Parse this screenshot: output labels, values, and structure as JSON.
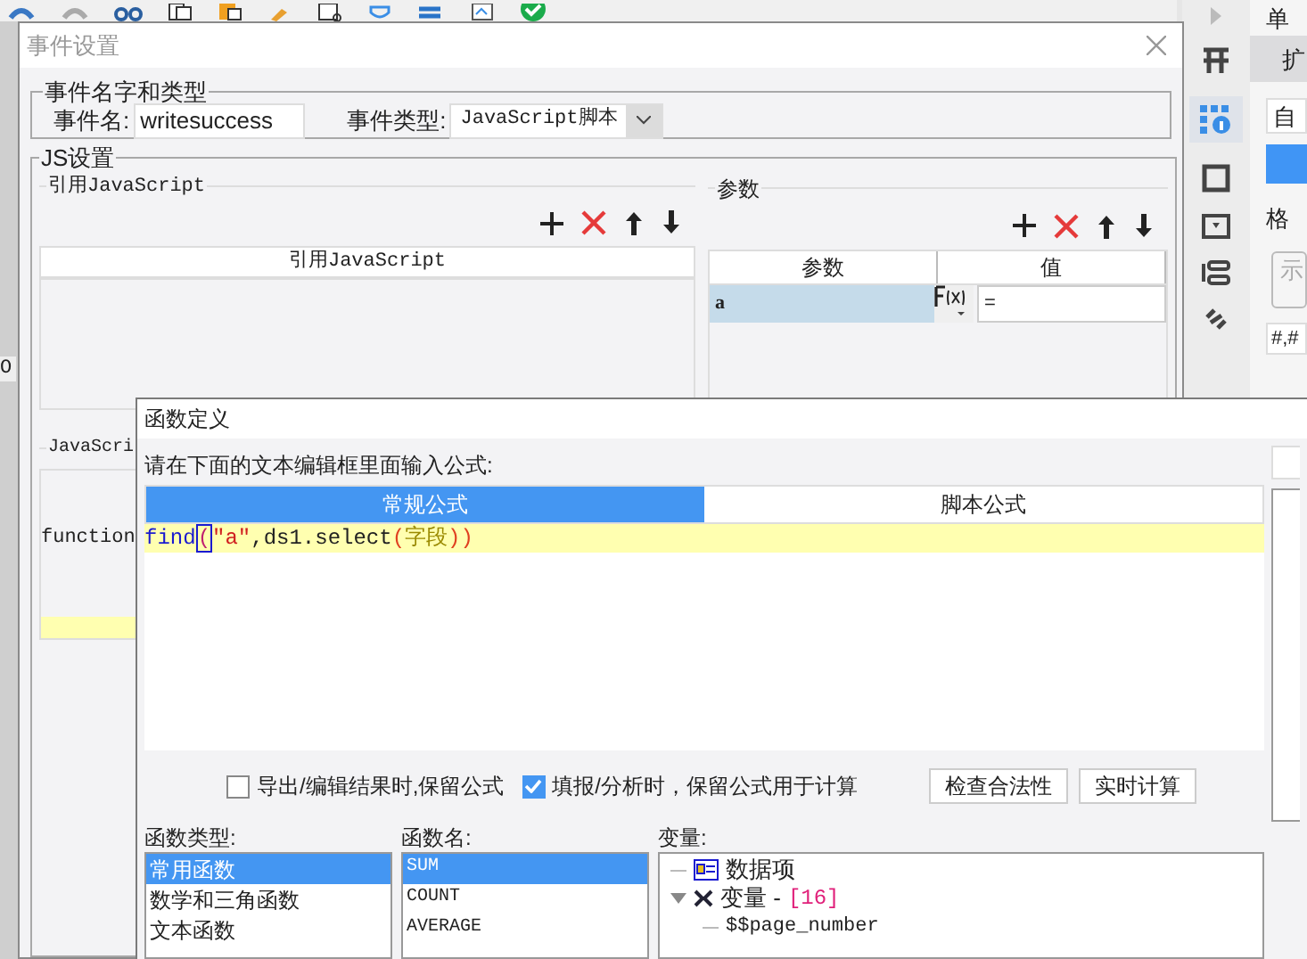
{
  "background": {
    "cell_text": "O"
  },
  "right_panel": {
    "title": "单",
    "tab": "扩",
    "format_field": "自",
    "format_label": "格",
    "sample_label": "示",
    "pattern_field": "#,#"
  },
  "event_dialog": {
    "title": "事件设置",
    "name_group": {
      "title": "事件名字和类型",
      "name_label": "事件名:",
      "name_value": "writesuccess",
      "type_label": "事件类型:",
      "type_value": "JavaScript脚本"
    },
    "js_group": {
      "title": "JS设置",
      "ref_section": {
        "title": "引用JavaScript",
        "column": "引用JavaScript"
      },
      "param_section": {
        "title": "参数",
        "columns": [
          "参数",
          "值"
        ],
        "rows": [
          {
            "name": "a",
            "value": "=",
            "selected": true
          }
        ]
      },
      "script_label": "JavaScri",
      "script_line": "function"
    }
  },
  "formula_dialog": {
    "title": "函数定义",
    "prompt": "请在下面的文本编辑框里面输入公式:",
    "tabs": [
      {
        "label": "常规公式",
        "selected": true
      },
      {
        "label": "脚本公式",
        "selected": false
      }
    ],
    "code_tokens": [
      {
        "text": "find",
        "kind": "function"
      },
      {
        "text": "(",
        "kind": "matched_paren"
      },
      {
        "text": "\"a\"",
        "kind": "string"
      },
      {
        "text": ",ds1.select",
        "kind": "plain"
      },
      {
        "text": "(",
        "kind": "paren"
      },
      {
        "text": "字段",
        "kind": "field"
      },
      {
        "text": ")",
        "kind": "paren"
      },
      {
        "text": ")",
        "kind": "paren"
      }
    ],
    "options": [
      {
        "label": "导出/编辑结果时,保留公式",
        "checked": false
      },
      {
        "label": "填报/分析时，保留公式用于计算",
        "checked": true
      }
    ],
    "buttons": [
      "检查合法性",
      "实时计算"
    ],
    "function_types": {
      "label": "函数类型:",
      "items": [
        {
          "label": "常用函数",
          "selected": true
        },
        {
          "label": "数学和三角函数",
          "selected": false
        },
        {
          "label": "文本函数",
          "selected": false
        }
      ]
    },
    "function_names": {
      "label": "函数名:",
      "items": [
        {
          "label": "SUM",
          "selected": true
        },
        {
          "label": "COUNT",
          "selected": false
        },
        {
          "label": "AVERAGE",
          "selected": false
        }
      ]
    },
    "variables": {
      "label": "变量:",
      "tree": [
        {
          "label": "数据项",
          "kind": "data"
        },
        {
          "label": "变量 -",
          "count": "[16]",
          "kind": "variable",
          "expanded": true,
          "children": [
            {
              "label": "$$page_number",
              "kind": "item"
            }
          ]
        }
      ]
    }
  }
}
